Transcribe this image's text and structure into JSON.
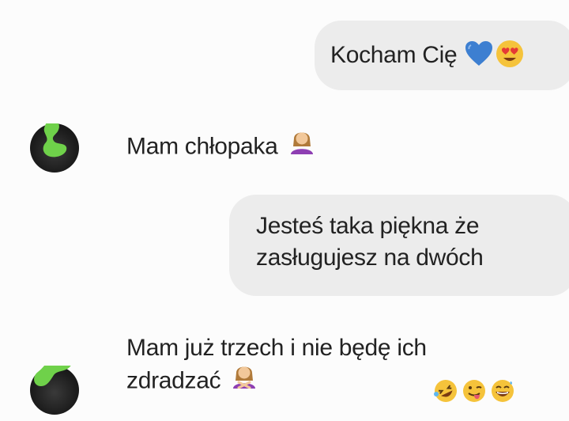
{
  "messages": {
    "out_1": {
      "text": "Kocham Cię"
    },
    "in_1": {
      "text": "Mam chłopaka"
    },
    "out_2": {
      "line1": "Jesteś taka piękna że",
      "line2": "zasługujesz na dwóch"
    },
    "in_2": {
      "line1": "Mam już trzech i nie będę ich",
      "line2": "zdradzać"
    }
  },
  "icons": {
    "out_1": [
      "blue-heart-icon",
      "heart-eyes-face-icon"
    ],
    "in_1": [
      "woman-shrugging-icon"
    ],
    "in_2": [
      "woman-gesturing-no-icon"
    ],
    "reactions": [
      "rolling-laughing-face-icon",
      "winking-tongue-face-icon",
      "grinning-sweat-face-icon"
    ]
  },
  "colors": {
    "background": "#fcfcfc",
    "bubble": "#ececec",
    "text": "#222222",
    "censor": "#6fd14a",
    "avatar": "#1c1c1c"
  }
}
